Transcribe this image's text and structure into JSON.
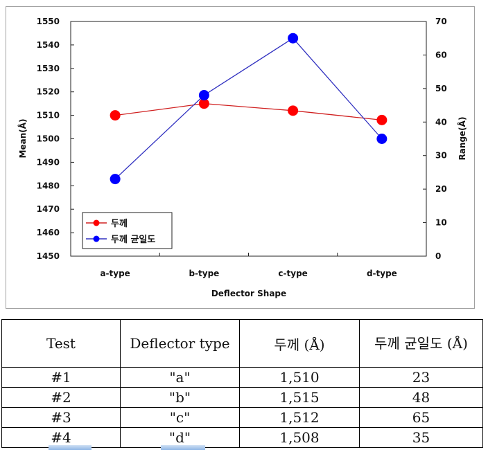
{
  "chart_data": {
    "type": "line",
    "categories": [
      "a-type",
      "b-type",
      "c-type",
      "d-type"
    ],
    "xlabel": "Deflector Shape",
    "ylabel": "Mean(Å)",
    "y2label": "Range(Å)",
    "ylim": [
      1450,
      1550
    ],
    "y2lim": [
      0,
      70
    ],
    "yticks": [
      1450,
      1460,
      1470,
      1480,
      1490,
      1500,
      1510,
      1520,
      1530,
      1540,
      1550
    ],
    "y2ticks": [
      0,
      10,
      20,
      30,
      40,
      50,
      60,
      70
    ],
    "grid": false,
    "legend_position": "bottom-left",
    "series": [
      {
        "name": "두께",
        "axis": "left",
        "color": "#ff0000",
        "line_color": "#d02020",
        "values": [
          1510,
          1515,
          1512,
          1508
        ]
      },
      {
        "name": "두께 균일도",
        "axis": "right",
        "color": "#0000ff",
        "line_color": "#3030c0",
        "values": [
          23,
          48,
          65,
          35
        ]
      }
    ]
  },
  "table": {
    "headers": [
      "Test",
      "Deflector type",
      "두께 (Å)",
      "두께 균일도 (Å)"
    ],
    "rows": [
      [
        "#1",
        "\"a\"",
        "1,510",
        "23"
      ],
      [
        "#2",
        "\"b\"",
        "1,515",
        "48"
      ],
      [
        "#3",
        "\"c\"",
        "1,512",
        "65"
      ],
      [
        "#4",
        "\"d\"",
        "1,508",
        "35"
      ]
    ]
  }
}
